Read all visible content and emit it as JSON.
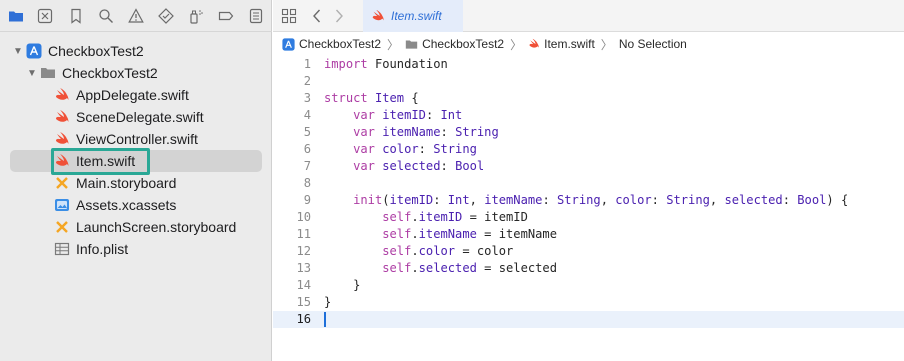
{
  "navigator": {
    "toolbar_icons": [
      "folder-icon",
      "source-control-icon",
      "bookmark-icon",
      "search-icon",
      "issue-warning-icon",
      "test-diamond-icon",
      "debug-spray-icon",
      "breakpoint-icon",
      "report-icon"
    ],
    "tree": [
      {
        "label": "CheckboxTest2",
        "kind": "project",
        "expanded": true
      },
      {
        "label": "CheckboxTest2",
        "kind": "folder",
        "expanded": true
      },
      {
        "label": "AppDelegate.swift",
        "kind": "swift"
      },
      {
        "label": "SceneDelegate.swift",
        "kind": "swift"
      },
      {
        "label": "ViewController.swift",
        "kind": "swift"
      },
      {
        "label": "Item.swift",
        "kind": "swift",
        "selected": true
      },
      {
        "label": "Main.storyboard",
        "kind": "storyboard"
      },
      {
        "label": "Assets.xcassets",
        "kind": "assets"
      },
      {
        "label": "LaunchScreen.storyboard",
        "kind": "storyboard"
      },
      {
        "label": "Info.plist",
        "kind": "plist"
      }
    ]
  },
  "editor": {
    "tab": {
      "label": "Item.swift"
    },
    "jumpbar": [
      "CheckboxTest2",
      "CheckboxTest2",
      "Item.swift",
      "No Selection"
    ],
    "line_numbers": [
      "1",
      "2",
      "3",
      "4",
      "5",
      "6",
      "7",
      "8",
      "9",
      "10",
      "11",
      "12",
      "13",
      "14",
      "15",
      "16"
    ],
    "current_line": 16
  },
  "colors": {
    "accent": "#2f6fd6",
    "highlight_box": "#2aa896",
    "keyword": "#ad3da4",
    "type": "#4b21b0",
    "property": "#3e7e8c",
    "swift_icon": "#f05138",
    "storyboard_icon": "#f5a623"
  }
}
